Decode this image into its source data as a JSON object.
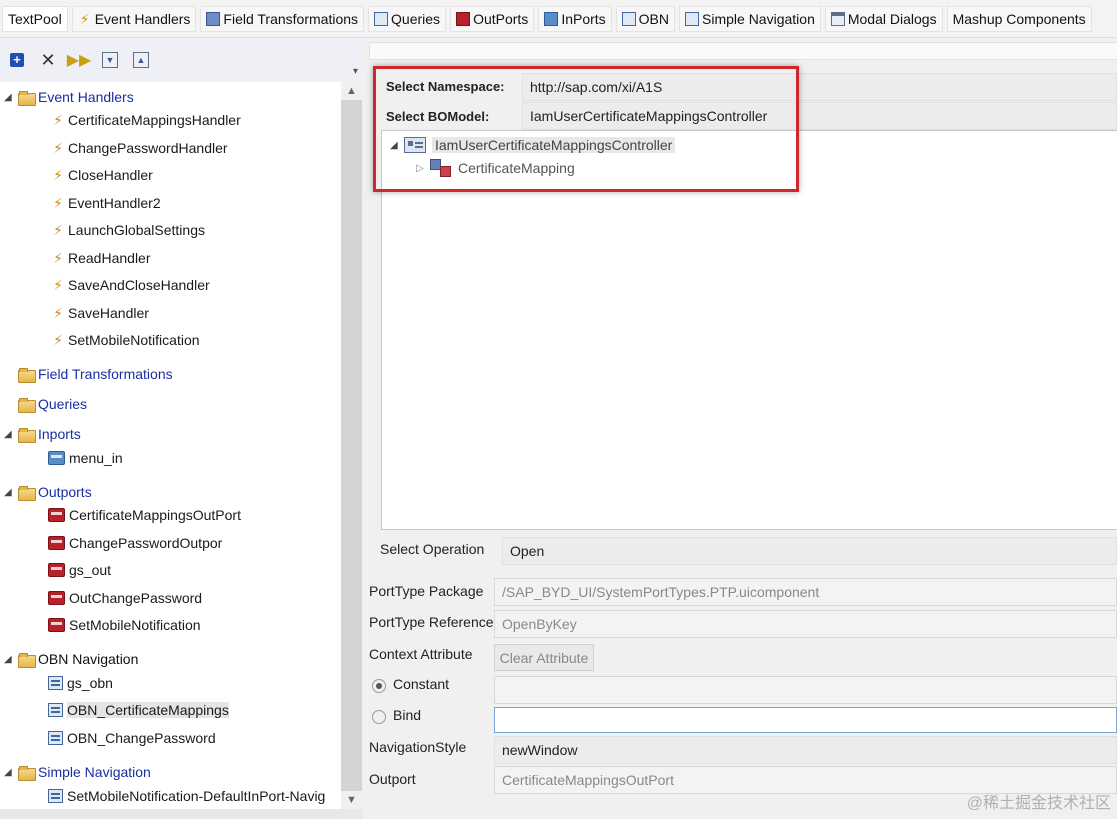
{
  "tabs": [
    {
      "label": "TextPool",
      "icon": "none"
    },
    {
      "label": "Event Handlers",
      "icon": "lightning-icon"
    },
    {
      "label": "Field Transformations",
      "icon": "transform-icon"
    },
    {
      "label": "Queries",
      "icon": "query-icon"
    },
    {
      "label": "OutPorts",
      "icon": "outport-icon"
    },
    {
      "label": "InPorts",
      "icon": "inport-icon"
    },
    {
      "label": "OBN",
      "icon": "obn-icon"
    },
    {
      "label": "Simple Navigation",
      "icon": "navigation-icon"
    },
    {
      "label": "Modal Dialogs",
      "icon": "dialog-icon"
    },
    {
      "label": "Mashup Components",
      "icon": "none"
    }
  ],
  "tree": {
    "event_handlers": {
      "label": "Event Handlers",
      "items": [
        "CertificateMappingsHandler",
        "ChangePasswordHandler",
        "CloseHandler",
        "EventHandler2",
        "LaunchGlobalSettings",
        "ReadHandler",
        "SaveAndCloseHandler",
        "SaveHandler",
        "SetMobileNotification"
      ]
    },
    "field_transformations": {
      "label": "Field Transformations"
    },
    "queries": {
      "label": "Queries"
    },
    "inports": {
      "label": "Inports",
      "items": [
        "menu_in"
      ]
    },
    "outports": {
      "label": "Outports",
      "items": [
        "CertificateMappingsOutPort",
        "ChangePasswordOutpor",
        "gs_out",
        "OutChangePassword",
        "SetMobileNotification"
      ]
    },
    "obn_navigation": {
      "label": "OBN Navigation",
      "items": [
        "gs_obn",
        "OBN_CertificateMappings",
        "OBN_ChangePassword"
      ]
    },
    "simple_navigation": {
      "label": "Simple Navigation",
      "items": [
        "SetMobileNotification-DefaultInPort-Navig"
      ]
    }
  },
  "form": {
    "namespace_label": "Select Namespace:",
    "namespace_value": "http://sap.com/xi/A1S",
    "bomodel_label": "Select BOModel:",
    "bomodel_value": "IamUserCertificateMappingsController",
    "bo_root": "IamUserCertificateMappingsController",
    "bo_child": "CertificateMapping",
    "operation_label": "Select Operation",
    "operation_value": "Open",
    "porttype_package_label": "PortType Package",
    "porttype_package_value": "/SAP_BYD_UI/SystemPortTypes.PTP.uicomponent",
    "porttype_reference_label": "PortType Reference",
    "porttype_reference_value": "OpenByKey",
    "context_attribute_label": "Context Attribute",
    "clear_attribute_label": "Clear Attribute",
    "constant_label": "Constant",
    "bind_label": "Bind",
    "navigation_style_label": "NavigationStyle",
    "navigation_style_value": "newWindow",
    "outport_label": "Outport",
    "outport_value": "CertificateMappingsOutPort"
  },
  "watermark": "@稀土掘金技术社区"
}
